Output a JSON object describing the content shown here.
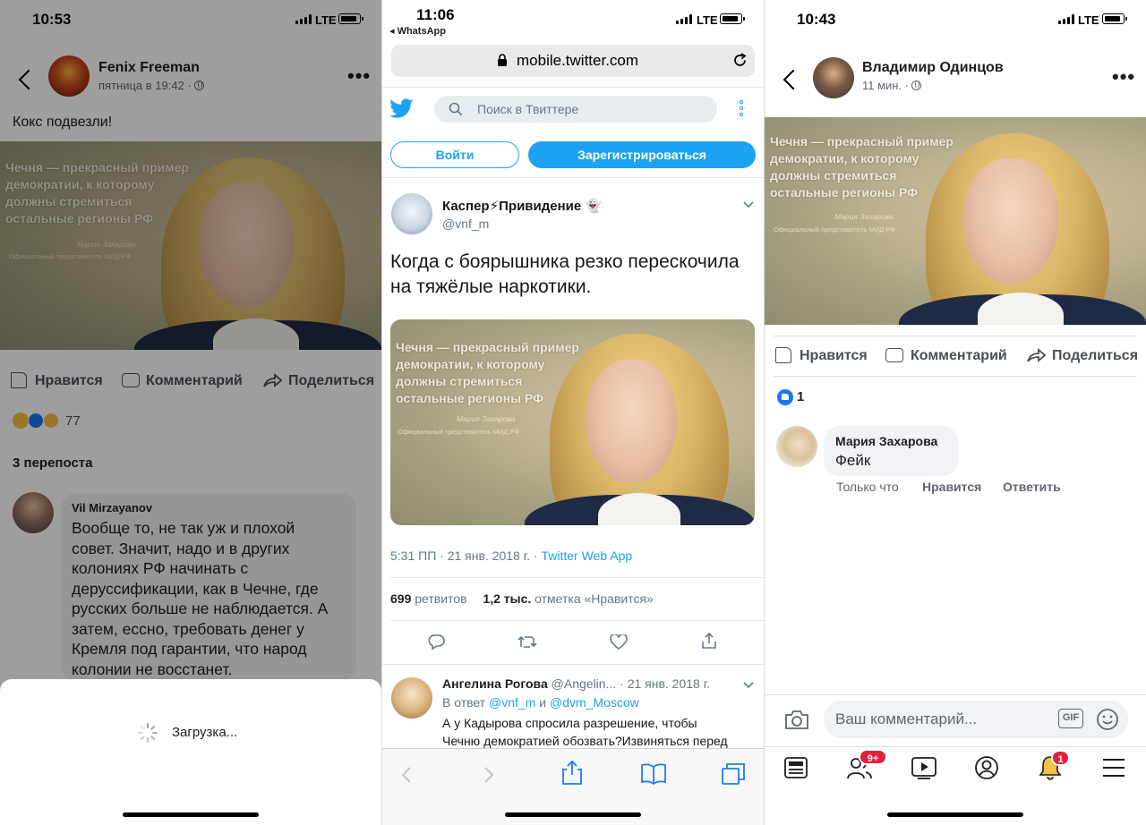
{
  "panel_left": {
    "status": {
      "time": "10:53",
      "network": "LTE"
    },
    "post": {
      "author": "Fenix Freeman",
      "time": "пятница в 19:42 ·",
      "text": "Кокс подвезли!",
      "image": {
        "quote": [
          "Чечня — прекрасный пример",
          "демократии, к которому",
          "должны стремиться",
          "остальные регионы РФ"
        ],
        "signature": "Мария Захарова",
        "role": "Официальный представитель МИД РФ"
      },
      "actions": {
        "like": "Нравится",
        "comment": "Комментарий",
        "share": "Поделиться"
      },
      "reactions_count": "77",
      "reposts": "3 перепоста"
    },
    "comment": {
      "author": "Vil Mirzayanov",
      "lines": [
        "Вообще то, не так уж и плохой",
        "совет. Значит, надо и в других",
        "колониях РФ начинать с",
        "деруссификации, как в Чечне, где",
        "русских больше не наблюдается. А",
        "затем, ессно, требовать денег у",
        "Кремля под гарантии, что народ",
        "колонии не восстанет."
      ]
    },
    "loading": "Загрузка..."
  },
  "panel_middle": {
    "status": {
      "time": "11:06",
      "network": "LTE",
      "back_app": "◂ WhatsApp"
    },
    "url": "mobile.twitter.com",
    "search_placeholder": "Поиск в Твиттере",
    "login": "Войти",
    "signup": "Зарегистрироваться",
    "tweet": {
      "name": "Каспер⚡Привидение 👻",
      "handle": "@vnf_m",
      "text_lines": [
        "Когда с боярышника резко перескочила",
        "на тяжёлые наркотики."
      ],
      "meta_time": "5:31 ПП · 21 янв. 2018 г. ·",
      "meta_source": "Twitter Web App",
      "retweets_num": "699",
      "retweets_label": "ретвитов",
      "likes_num": "1,2 тыс.",
      "likes_label": "отметка «Нравится»"
    },
    "reply": {
      "name": "Ангелина Рогова",
      "handle": "@Angelin...",
      "date": "· 21 янв. 2018 г.",
      "reply_to_prefix": "В ответ",
      "reply_to_1": "@vnf_m",
      "reply_and": "и",
      "reply_to_2": "@dvm_Moscow",
      "text_lines": [
        "А у Кадырова спросила разрешение, чтобы",
        "Чечню демократией обозвать?Извиняться перед"
      ]
    }
  },
  "panel_right": {
    "status": {
      "time": "10:43",
      "network": "LTE"
    },
    "post": {
      "author": "Владимир Одинцов",
      "time": "11 мин. ·",
      "actions": {
        "like": "Нравится",
        "comment": "Комментарий",
        "share": "Поделиться"
      },
      "likes_count": "1"
    },
    "comment": {
      "author": "Мария Захарова",
      "text": "Фейк",
      "time": "Только что",
      "like": "Нравится",
      "reply": "Ответить"
    },
    "input_placeholder": "Ваш комментарий...",
    "gif_label": "GIF",
    "badges": {
      "friends": "9+",
      "notifications": "1"
    }
  },
  "colors": {
    "fb_blue": "#1877f2",
    "twitter_blue": "#1da1f2",
    "badge_red": "#e41e3f"
  }
}
